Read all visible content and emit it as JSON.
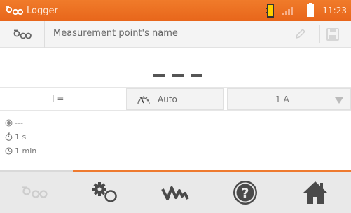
{
  "header": {
    "title": "Logger",
    "time": "11:23",
    "app_icon": "logger-icon",
    "memory_icon": "memory-card-icon",
    "signal_icon": "signal-icon",
    "battery_icon": "battery-icon"
  },
  "name_field": {
    "placeholder": "Measurement point's name",
    "edit_icon": "pencil-icon",
    "save_icon": "floppy-disk-icon"
  },
  "measurement": {
    "value": "- - -"
  },
  "parameters": {
    "current_label": "I = ---",
    "mode_label": "Auto",
    "range_label": "1 A"
  },
  "info": {
    "status": "---",
    "interval": "1 s",
    "duration": "1 min"
  },
  "toolbar": {
    "items": [
      {
        "name": "logger",
        "icon": "logger-icon",
        "active": false
      },
      {
        "name": "settings",
        "icon": "gears-icon"
      },
      {
        "name": "measurements",
        "icon": "waveform-icon"
      },
      {
        "name": "help",
        "icon": "help-icon"
      },
      {
        "name": "home",
        "icon": "home-icon"
      }
    ]
  },
  "colors": {
    "accent": "#ee7a2f",
    "titlebar": "#e8661b",
    "toolbar_bg": "#e9e9e9",
    "icon_dark": "#4a4a4a"
  }
}
